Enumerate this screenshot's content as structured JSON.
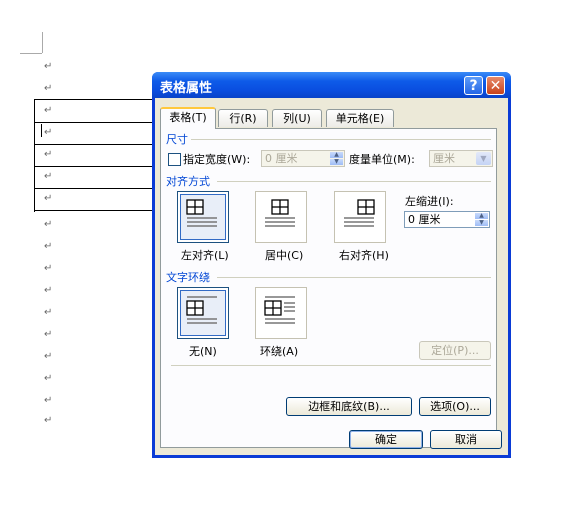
{
  "document": {
    "paragraph_mark": "↵",
    "table_cell_mark": "↵"
  },
  "dialog": {
    "title": "表格属性",
    "help_glyph": "?",
    "close_glyph": "✕",
    "tabs": [
      {
        "label": "表格(T)"
      },
      {
        "label": "行(R)"
      },
      {
        "label": "列(U)"
      },
      {
        "label": "单元格(E)"
      }
    ],
    "active_tab": "表格(T)",
    "size": {
      "heading": "尺寸",
      "preferred_width_label": "指定宽度(W):",
      "preferred_width_checked": false,
      "preferred_width_value": "0 厘米",
      "measure_in_label": "度量单位(M):",
      "measure_in_value": "厘米"
    },
    "alignment": {
      "heading": "对齐方式",
      "options": [
        {
          "label": "左对齐(L)",
          "selected": true
        },
        {
          "label": "居中(C)",
          "selected": false
        },
        {
          "label": "右对齐(H)",
          "selected": false
        }
      ],
      "indent_label": "左缩进(I):",
      "indent_value": "0 厘米"
    },
    "wrapping": {
      "heading": "文字环绕",
      "options": [
        {
          "label": "无(N)",
          "selected": true
        },
        {
          "label": "环绕(A)",
          "selected": false
        }
      ],
      "positioning_button": "定位(P)..."
    },
    "borders_button": "边框和底纹(B)...",
    "options_button": "选项(O)...",
    "ok_button": "确定",
    "cancel_button": "取消"
  },
  "colors": {
    "title_bar": "#0a4ee0",
    "dialog_face": "#ece9d8",
    "section_heading": "#0046d5",
    "selection_accent": "#316ac5"
  }
}
